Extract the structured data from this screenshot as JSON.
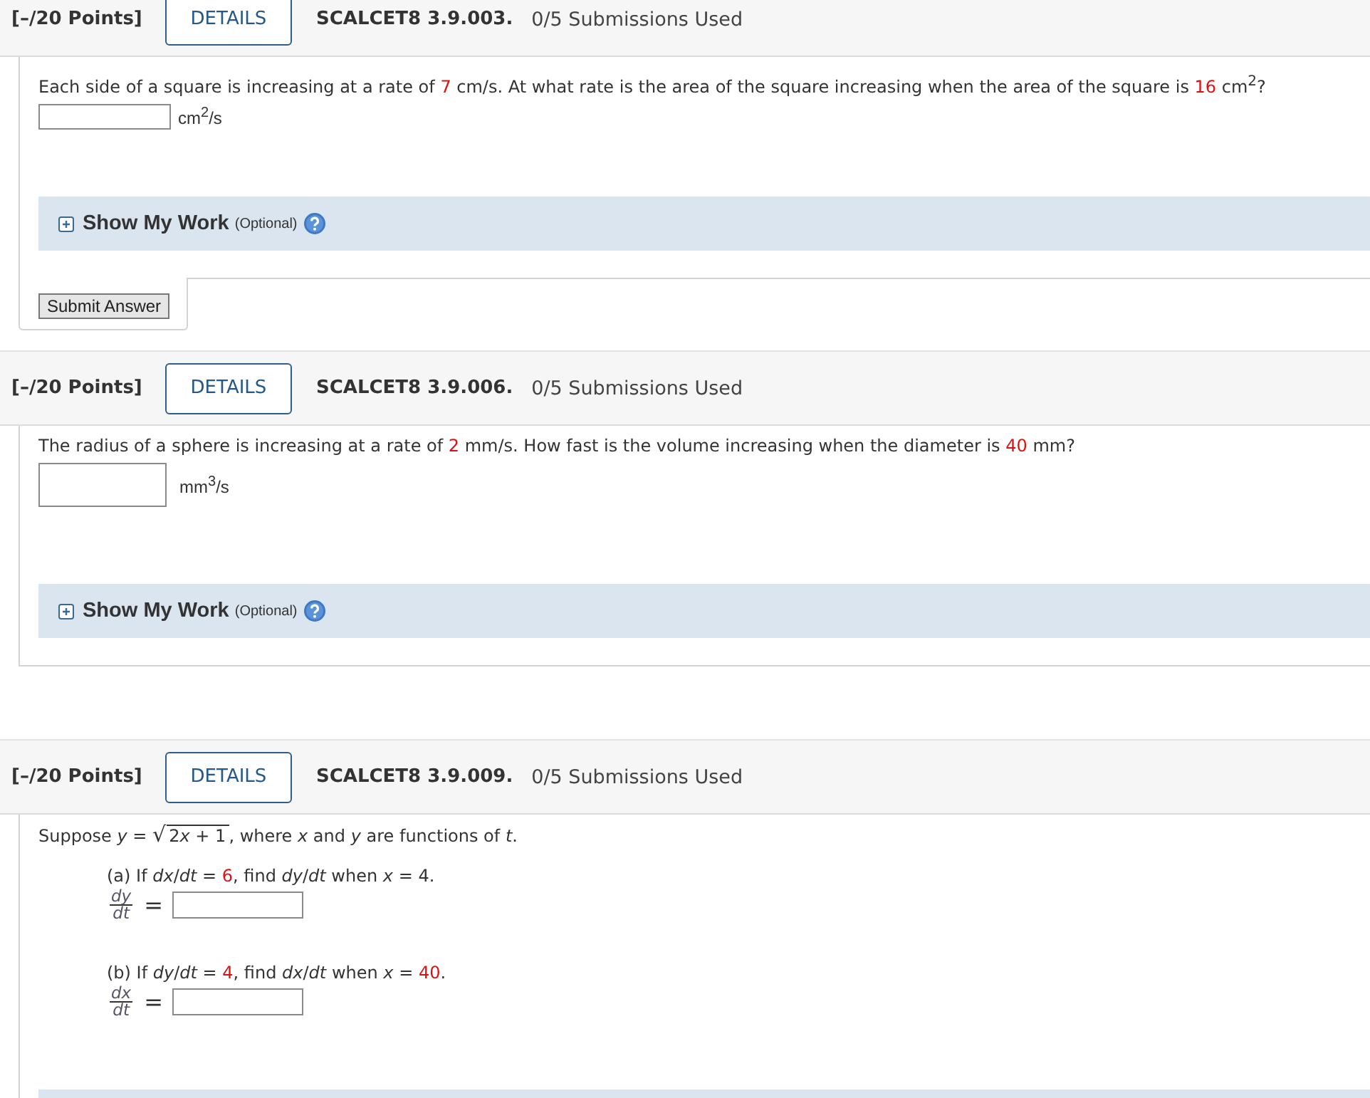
{
  "problems": [
    {
      "points": "[–/20 Points]",
      "details_button": "DETAILS",
      "code": "SCALCET8 3.9.003.",
      "submissions": "0/5 Submissions Used",
      "question": [
        {
          "kind": "plain",
          "text": "Each side of a square is increasing at a rate of "
        },
        {
          "kind": "given",
          "text": "7"
        },
        {
          "kind": "plain",
          "text": " cm/s. At what rate is the area of the square increasing when the area of the square is "
        },
        {
          "kind": "given",
          "text": "16"
        },
        {
          "kind": "plain",
          "text": " cm$^{2}$?"
        }
      ],
      "answers": [
        {
          "kind": "inline",
          "unit": "cm$^{2}$/s"
        }
      ],
      "show_work": {
        "kind": "collapsed",
        "label": "Show My Work",
        "note": "(Optional)"
      },
      "submit_button": "Submit Answer"
    },
    {
      "points": "[–/20 Points]",
      "details_button": "DETAILS",
      "code": "SCALCET8 3.9.006.",
      "submissions": "0/5 Submissions Used",
      "question": [
        {
          "kind": "plain",
          "text": "The radius of a sphere is increasing at a rate of "
        },
        {
          "kind": "given",
          "text": "2"
        },
        {
          "kind": "plain",
          "text": " mm/s. How fast is the volume increasing when the diameter is "
        },
        {
          "kind": "given",
          "text": "40"
        },
        {
          "kind": "plain",
          "text": " mm?"
        }
      ],
      "answers": [
        {
          "kind": "tall",
          "unit": "mm$^{3}$/s"
        }
      ],
      "show_work": {
        "kind": "collapsed",
        "label": "Show My Work",
        "note": "(Optional)"
      }
    },
    {
      "points": "[–/20 Points]",
      "details_button": "DETAILS",
      "code": "SCALCET8 3.9.009.",
      "submissions": "0/5 Submissions Used",
      "question": [
        {
          "kind": "plain",
          "text": "Suppose  *y* = "
        },
        {
          "kind": "sqrt",
          "sign": "√",
          "radicand": [
            {
              "kind": "plain",
              "text": "2"
            },
            {
              "kind": "math",
              "text": "x"
            },
            {
              "kind": "plain",
              "text": " + 1"
            }
          ]
        },
        {
          "kind": "plain",
          "text": ",  where *x* and *y* are functions of *t*."
        }
      ],
      "answers": [
        {
          "kind": "part",
          "prompt": [
            {
              "kind": "plain",
              "text": "(a) If  *dx*/*dt* = "
            },
            {
              "kind": "given",
              "text": "6"
            },
            {
              "kind": "plain",
              "text": ",  find  *dy*/*dt*  when  *x* = 4."
            }
          ],
          "numerator": "dy",
          "denominator": "dt",
          "equals": "="
        },
        {
          "kind": "part",
          "prompt": [
            {
              "kind": "plain",
              "text": "(b) If  *dy*/*dt* = "
            },
            {
              "kind": "given",
              "text": "4"
            },
            {
              "kind": "plain",
              "text": ",  find  *dx*/*dt*  when  *x* = "
            },
            {
              "kind": "given",
              "text": "40"
            },
            {
              "kind": "plain",
              "text": "."
            }
          ],
          "numerator": "dx",
          "denominator": "dt",
          "equals": "="
        }
      ],
      "show_work": {
        "kind": "cut_off"
      }
    }
  ]
}
